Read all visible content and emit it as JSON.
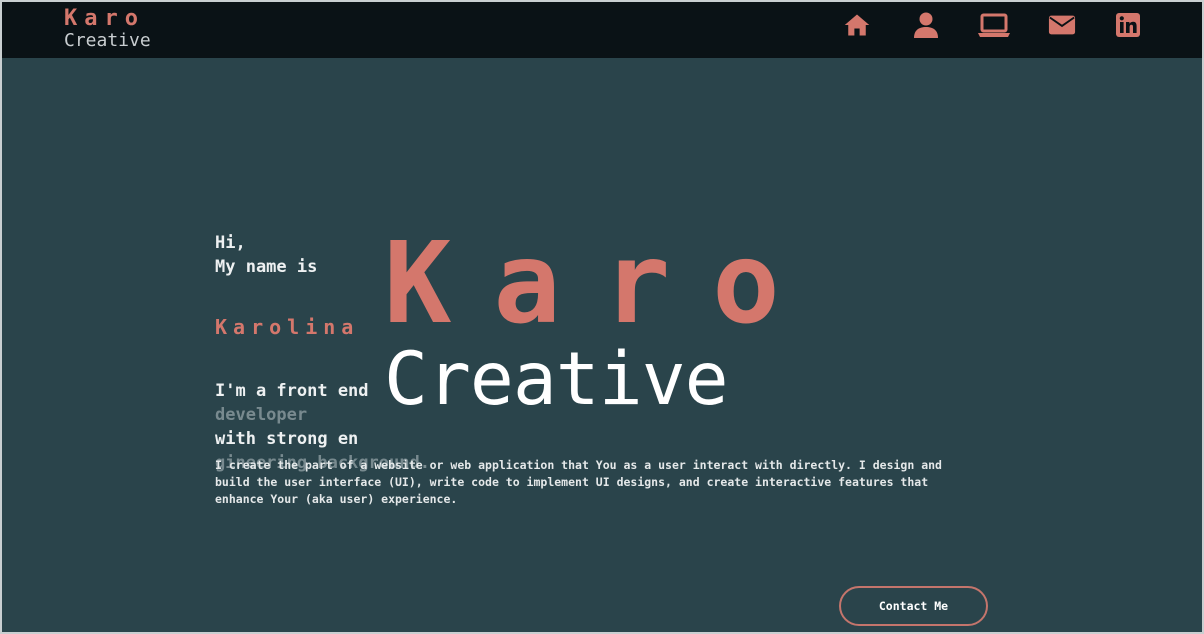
{
  "brand": {
    "line1": "Karo",
    "line2": "Creative",
    "accent_color": "#d4776c",
    "nav_bg": "#0a1216",
    "page_bg": "#2a444b"
  },
  "nav": {
    "icons": [
      {
        "name": "home-icon"
      },
      {
        "name": "user-icon"
      },
      {
        "name": "laptop-icon"
      },
      {
        "name": "mail-icon"
      },
      {
        "name": "linkedin-icon"
      }
    ]
  },
  "hero": {
    "greeting_line1": "Hi,",
    "greeting_line2": "My name is",
    "name": "Karolina",
    "role_line1_a": "I'm a front end",
    "role_line1_b": " developer",
    "role_line2_a": "with strong en",
    "role_line2_b": "gineering background.",
    "bio": "I create the part of a website or web application that You as a user interact with directly. I design and build the user interface (UI), write code to implement UI designs, and create interactive features that enhance Your (aka user) experience.",
    "overlay_line1": "Karo",
    "overlay_line2": "Creative"
  },
  "cta": {
    "contact_label": "Contact Me"
  }
}
